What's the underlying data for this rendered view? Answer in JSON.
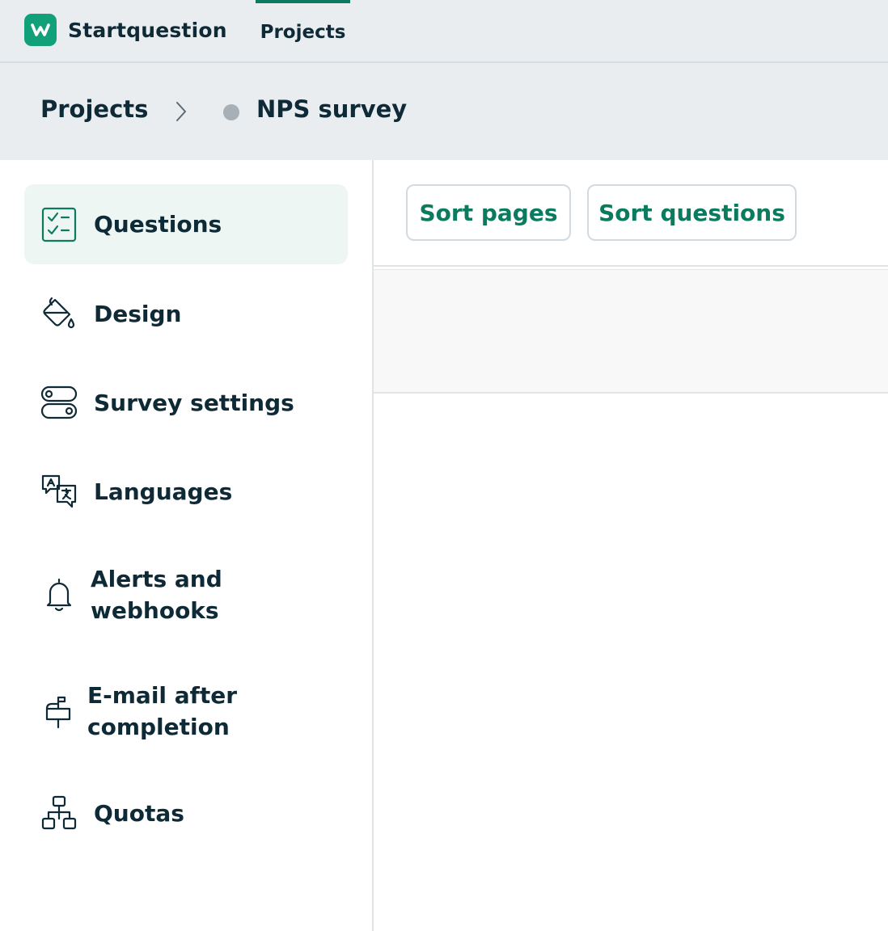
{
  "colors": {
    "brand": "#12a07a",
    "accent": "#0b7a5f",
    "text": "#0f2a37",
    "status_dot": "#a7b0b6",
    "active_bg": "#eef6f4"
  },
  "topbar": {
    "logo_icon": "w-logo-icon",
    "brand_name": "Startquestion",
    "nav_tab": "Projects"
  },
  "breadcrumb": {
    "root": "Projects",
    "separator_icon": "chevron-right-icon",
    "status_icon": "status-dot-icon",
    "current": "NPS survey"
  },
  "sidebar": {
    "items": [
      {
        "label": "Questions",
        "icon": "checklist-icon",
        "active": true
      },
      {
        "label": "Design",
        "icon": "paint-bucket-icon",
        "active": false
      },
      {
        "label": "Survey settings",
        "icon": "toggles-icon",
        "active": false
      },
      {
        "label": "Languages",
        "icon": "translate-icon",
        "active": false
      },
      {
        "label": "Alerts and\nwebhooks",
        "icon": "bell-icon",
        "active": false
      },
      {
        "label": "E-mail after\ncompletion",
        "icon": "mailbox-icon",
        "active": false
      },
      {
        "label": "Quotas",
        "icon": "hierarchy-icon",
        "active": false
      }
    ]
  },
  "toolbar": {
    "sort_pages": "Sort pages",
    "sort_questions": "Sort questions"
  }
}
